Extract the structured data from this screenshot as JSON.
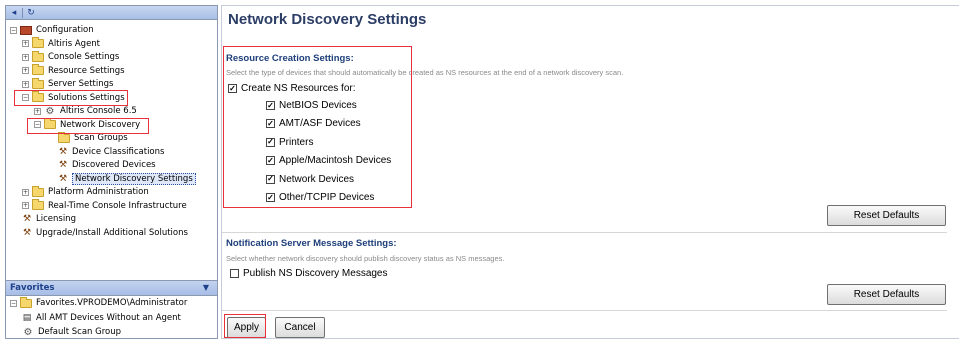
{
  "left_pane": {
    "toolbar": {
      "back_icon": "back-arrow-icon",
      "refresh_icon": "refresh-icon"
    },
    "tree": [
      {
        "label": "Configuration",
        "icon": "configuration-icon",
        "expander": "⊟"
      },
      {
        "label": "Altiris Agent",
        "icon": "folder-icon",
        "expander": "⊞"
      },
      {
        "label": "Console Settings",
        "icon": "folder-icon",
        "expander": "⊞"
      },
      {
        "label": "Resource Settings",
        "icon": "folder-icon",
        "expander": "⊞"
      },
      {
        "label": "Server Settings",
        "icon": "folder-icon",
        "expander": "⊞"
      },
      {
        "label": "Solutions Settings",
        "icon": "folder-icon",
        "expander": "⊟"
      },
      {
        "label": "Altiris Console 6.5",
        "icon": "gear-icon",
        "expander": "⊞"
      },
      {
        "label": "Network Discovery",
        "icon": "folder-icon",
        "expander": "⊟"
      },
      {
        "label": "Scan Groups",
        "icon": "folder-icon",
        "expander": ""
      },
      {
        "label": "Device Classifications",
        "icon": "tool-icon",
        "expander": ""
      },
      {
        "label": "Discovered Devices",
        "icon": "tool-icon",
        "expander": ""
      },
      {
        "label": "Network Discovery Settings",
        "icon": "tool-icon",
        "expander": "",
        "selected": true
      },
      {
        "label": "Platform Administration",
        "icon": "folder-icon",
        "expander": "⊞"
      },
      {
        "label": "Real-Time Console Infrastructure",
        "icon": "folder-icon",
        "expander": "⊞"
      },
      {
        "label": "Licensing",
        "icon": "tool-icon",
        "expander": ""
      },
      {
        "label": "Upgrade/Install Additional Solutions",
        "icon": "tool-icon",
        "expander": ""
      }
    ],
    "favorites": {
      "header": "Favorites",
      "items": [
        {
          "label": "Favorites.VPRODEMO\\Administrator",
          "icon": "favorites-folder-icon",
          "expander": "⊟"
        },
        {
          "label": "All AMT Devices Without an Agent",
          "icon": "report-icon",
          "expander": ""
        },
        {
          "label": "Default Scan Group",
          "icon": "scan-group-icon",
          "expander": ""
        }
      ]
    }
  },
  "main": {
    "title": "Network Discovery Settings",
    "resource_section": {
      "title": "Resource Creation Settings:",
      "description": "Select the type of devices that should automatically be created as NS resources at the end of a network discovery scan.",
      "master_checkbox": {
        "label": "Create NS Resources for:",
        "checked": true
      },
      "device_checkboxes": [
        {
          "label": "NetBIOS Devices",
          "checked": true
        },
        {
          "label": "AMT/ASF Devices",
          "checked": true
        },
        {
          "label": "Printers",
          "checked": true
        },
        {
          "label": "Apple/Macintosh Devices",
          "checked": true
        },
        {
          "label": "Network Devices",
          "checked": true
        },
        {
          "label": "Other/TCPIP Devices",
          "checked": true
        }
      ],
      "reset_label": "Reset Defaults"
    },
    "notification_section": {
      "title": "Notification Server Message Settings:",
      "description": "Select whether network discovery should publish discovery status as NS messages.",
      "checkbox": {
        "label": "Publish NS Discovery Messages",
        "checked": false
      },
      "reset_label": "Reset Defaults"
    },
    "apply_label": "Apply",
    "cancel_label": "Cancel"
  },
  "colors": {
    "highlight_box": "#e8313a",
    "title": "#2c3e66",
    "section_title": "#1e3f7a",
    "pane_header": "#a8bfe6"
  }
}
